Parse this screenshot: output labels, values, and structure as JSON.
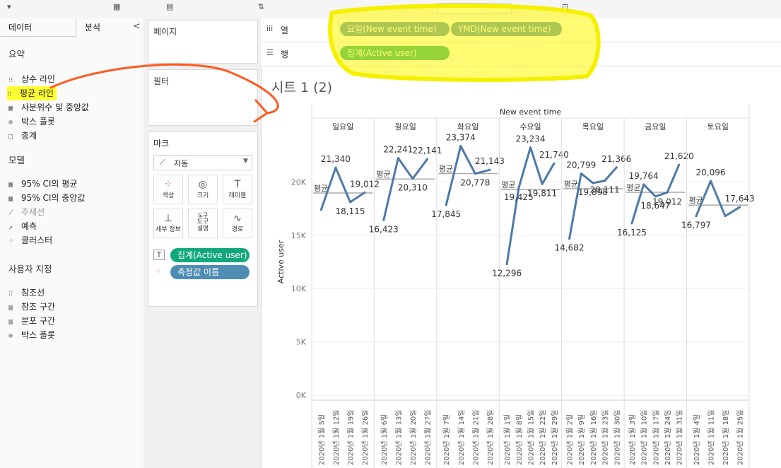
{
  "left_panel": {
    "tabs": [
      "데이터",
      "분석"
    ],
    "collapse_glyph": "<",
    "sections": [
      {
        "title": "요약",
        "items": [
          {
            "label": "상수 라인",
            "icon": "constant-line-icon",
            "glyph": "⁝⁝",
            "highlight": false
          },
          {
            "label": "평균 라인",
            "icon": "average-line-icon",
            "glyph": "⁝⁝",
            "highlight": true
          },
          {
            "label": "사분위수 및 중앙값",
            "icon": "quartile-icon",
            "glyph": "▦",
            "highlight": false
          },
          {
            "label": "박스 플롯",
            "icon": "box-plot-icon",
            "glyph": "⊕",
            "highlight": false
          },
          {
            "label": "총계",
            "icon": "totals-icon",
            "glyph": "□",
            "highlight": false
          }
        ]
      },
      {
        "title": "모델",
        "items": [
          {
            "label": "95% CI의 평균",
            "icon": "ci-mean-icon",
            "glyph": "▦",
            "highlight": false
          },
          {
            "label": "95% CI의 중앙값",
            "icon": "ci-median-icon",
            "glyph": "▦",
            "highlight": false
          },
          {
            "label": "추세선",
            "icon": "trend-line-icon",
            "glyph": "⟋",
            "highlight": false,
            "dim": true
          },
          {
            "label": "예측",
            "icon": "forecast-icon",
            "glyph": "↗",
            "highlight": false
          },
          {
            "label": "클러스터",
            "icon": "cluster-icon",
            "glyph": "⁘",
            "highlight": false
          }
        ]
      },
      {
        "title": "사용자 지정",
        "items": [
          {
            "label": "참조선",
            "icon": "reference-line-icon",
            "glyph": "⁝⁝",
            "highlight": false
          },
          {
            "label": "참조 구간",
            "icon": "reference-band-icon",
            "glyph": "▥",
            "highlight": false
          },
          {
            "label": "분포 구간",
            "icon": "distribution-band-icon",
            "glyph": "▥",
            "highlight": false
          },
          {
            "label": "박스 플롯",
            "icon": "box-plot-icon",
            "glyph": "⊕",
            "highlight": false
          }
        ]
      }
    ]
  },
  "cards": {
    "pages": "페이지",
    "filters": "필터",
    "marks": "마크",
    "mark_type": "자동",
    "buttons": [
      {
        "label": "색상",
        "icon": "color-icon",
        "glyph": "⁘"
      },
      {
        "label": "크기",
        "icon": "size-icon",
        "glyph": "◎"
      },
      {
        "label": "레이블",
        "icon": "label-icon",
        "glyph": "T"
      },
      {
        "label": "세부 정보",
        "icon": "detail-icon",
        "glyph": "⊥"
      },
      {
        "label": "도구\n설명",
        "icon": "tooltip-icon",
        "glyph": "도구 설명"
      },
      {
        "label": "경로",
        "icon": "path-icon",
        "glyph": "∿"
      }
    ],
    "mark_pills": [
      {
        "label": "집계(Active user)",
        "icon": "text-icon",
        "glyph": "T",
        "color": "#12a97a"
      },
      {
        "label": "측정값 이름",
        "icon": "color-dots-icon",
        "glyph": "⁘",
        "color": "#4d8db4"
      }
    ]
  },
  "shelves": {
    "columns_label": "열",
    "rows_label": "행",
    "columns_pills": [
      {
        "label": "요일(New event time)",
        "color": "#4d8db4"
      },
      {
        "label": "YMD(New event time)",
        "color": "#4d8db4"
      }
    ],
    "rows_pills": [
      {
        "label": "집계(Active user)",
        "color": "#12a97a"
      }
    ]
  },
  "sheet_title": "시트 1 (2)",
  "chart_data": {
    "type": "line",
    "column_header": "New event time",
    "ylabel": "Active user",
    "ylim": [
      0,
      25000
    ],
    "yticks": [
      "0K",
      "5K",
      "10K",
      "15K",
      "20K"
    ],
    "avg_label": "평균",
    "line_color": "#4e79a7",
    "panels": [
      {
        "name": "일요일",
        "dates": [
          "2020년 1월 5일",
          "2020년 1월 12일",
          "2020년 1월 19일",
          "2020년 1월 26일"
        ],
        "values": [
          17400,
          21340,
          18115,
          19012
        ],
        "labels": [
          "",
          "21,340",
          "18,115",
          "19,012"
        ],
        "average": 18967
      },
      {
        "name": "월요일",
        "dates": [
          "2020년 1월 6일",
          "2020년 1월 13일",
          "2020년 1월 20일",
          "2020년 1월 27일"
        ],
        "values": [
          16423,
          22241,
          20310,
          22141
        ],
        "labels": [
          "16,423",
          "22,241",
          "20,310",
          "22,141"
        ],
        "average": 20279
      },
      {
        "name": "화요일",
        "dates": [
          "2020년 1월 7일",
          "2020년 1월 14일",
          "2020년 1월 21일",
          "2020년 1월 28일"
        ],
        "values": [
          17845,
          23374,
          20778,
          21143
        ],
        "labels": [
          "17,845",
          "23,374",
          "20,778",
          "21,143"
        ],
        "average": 20785
      },
      {
        "name": "수요일",
        "dates": [
          "2020년 1월 1일",
          "2020년 1월 8일",
          "2020년 1월 15일",
          "2020년 1월 22일",
          "2020년 1월 29일"
        ],
        "values": [
          12296,
          19425,
          23234,
          19811,
          21740
        ],
        "labels": [
          "12,296",
          "19,425",
          "23,234",
          "19,811",
          "21,740"
        ],
        "average": 19301
      },
      {
        "name": "목요일",
        "dates": [
          "2020년 1월 2일",
          "2020년 1월 9일",
          "2020년 1월 16일",
          "2020년 1월 23일",
          "2020년 1월 30일"
        ],
        "values": [
          14682,
          20799,
          19898,
          20111,
          21366
        ],
        "labels": [
          "14,682",
          "20,799",
          "19,898",
          "20,111",
          "21,366"
        ],
        "average": 19371
      },
      {
        "name": "금요일",
        "dates": [
          "2020년 1월 3일",
          "2020년 1월 10일",
          "2020년 1월 17일",
          "2020년 1월 24일",
          "2020년 1월 31일"
        ],
        "values": [
          16125,
          19764,
          18647,
          19012,
          21620
        ],
        "labels": [
          "16,125",
          "19,764",
          "18,647",
          "19,012",
          "21,620"
        ],
        "average": 19034
      },
      {
        "name": "토요일",
        "dates": [
          "2020년 1월 4일",
          "2020년 1월 11일",
          "2020년 1월 18일",
          "2020년 1월 25일"
        ],
        "values": [
          16797,
          20096,
          16800,
          17643
        ],
        "labels": [
          "16,797",
          "20,096",
          "",
          "17,643"
        ],
        "average": 17834
      }
    ]
  }
}
